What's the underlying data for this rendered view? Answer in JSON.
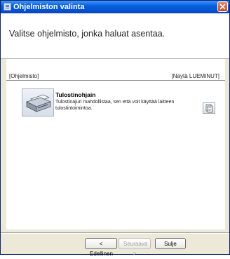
{
  "window": {
    "title": "Ohjelmiston valinta"
  },
  "header": {
    "heading": "Valitse ohjelmisto, jonka haluat asentaa."
  },
  "list": {
    "left_label": "[Ohjelmisto]",
    "right_label": "[Näytä LUEMINUT]",
    "items": [
      {
        "title": "Tulostinohjain",
        "description": "Tulostinajuri mahdollistaa, sen että voit käyttää laitteen tulostintoimintoa.",
        "icon": "printer-icon",
        "readme_icon": "document-icon"
      }
    ]
  },
  "footer": {
    "back_label": "< Edellinen",
    "next_label": "Seuraava >",
    "close_label": "Sulje"
  }
}
